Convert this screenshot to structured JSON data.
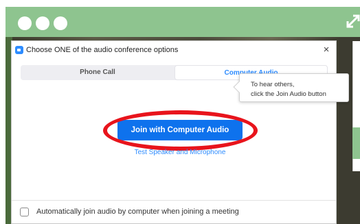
{
  "dialog": {
    "title": "Choose ONE of the audio conference options",
    "close_glyph": "×"
  },
  "tabs": [
    {
      "label": "Phone Call",
      "selected": false
    },
    {
      "label": "Computer Audio",
      "selected": true
    }
  ],
  "join_button": {
    "label": "Join with Computer Audio"
  },
  "test_link": {
    "label": "Test Speaker and Microphone"
  },
  "tooltip": {
    "line1": "To hear others,",
    "line2": "click the Join Audio button"
  },
  "footer": {
    "checkbox_label": "Automatically join audio by computer when joining a meeting",
    "checked": false
  },
  "colors": {
    "accent": "#2d8cff",
    "button": "#0e72ed",
    "highlight_ring": "#e8141c",
    "header_green": "#8ec48f"
  },
  "icons": [
    "zoom-app-icon",
    "close-icon",
    "expand-icon",
    "window-dot-icon"
  ]
}
